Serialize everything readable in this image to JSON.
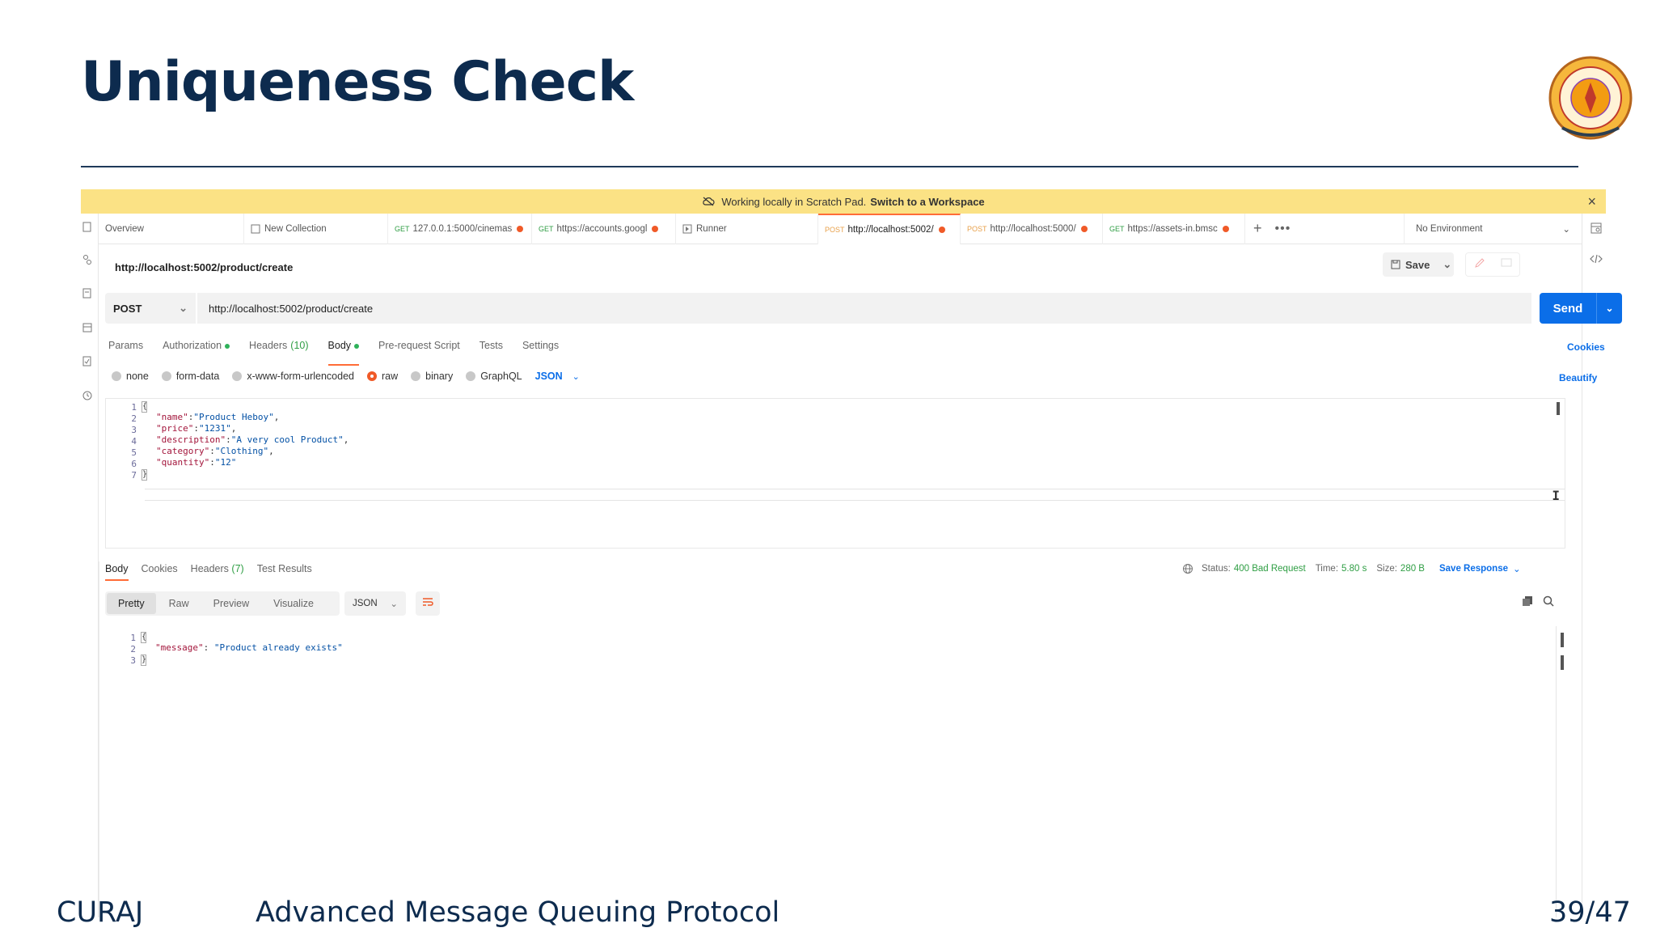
{
  "slide": {
    "title": "Uniqueness Check",
    "footer_left": "CURAJ",
    "footer_center": "Advanced Message Queuing Protocol",
    "footer_right": "39/47"
  },
  "colors": {
    "accent": "#ff6c37",
    "primary": "#0b6ee8",
    "title": "#0d2b4e",
    "banner": "#fbe285",
    "success": "#2f9e44"
  },
  "banner": {
    "text": "Working locally in Scratch Pad.",
    "link": "Switch to a Workspace"
  },
  "tabs": [
    {
      "label": "Overview"
    },
    {
      "label": "New Collection"
    },
    {
      "method": "GET",
      "label": "127.0.0.1:5000/cinemas"
    },
    {
      "method": "GET",
      "label": "https://accounts.googl"
    },
    {
      "label": "Runner"
    },
    {
      "method": "POST",
      "label": "http://localhost:5002/"
    },
    {
      "method": "POST",
      "label": "http://localhost:5000/"
    },
    {
      "method": "GET",
      "label": "https://assets-in.bmsc"
    }
  ],
  "environment": "No Environment",
  "request": {
    "name": "http://localhost:5002/product/create",
    "method": "POST",
    "url": "http://localhost:5002/product/create",
    "save_label": "Save",
    "send_label": "Send"
  },
  "req_tabs": {
    "params": "Params",
    "authorization": "Authorization",
    "headers": "Headers",
    "headers_count": "(10)",
    "body": "Body",
    "prerequest": "Pre-request Script",
    "tests": "Tests",
    "settings": "Settings",
    "cookies": "Cookies"
  },
  "body_types": {
    "none": "none",
    "form_data": "form-data",
    "urlencoded": "x-www-form-urlencoded",
    "raw": "raw",
    "binary": "binary",
    "graphql": "GraphQL",
    "format": "JSON",
    "beautify": "Beautify"
  },
  "request_body": {
    "line_numbers": [
      "1",
      "2",
      "3",
      "4",
      "5",
      "6",
      "7"
    ],
    "brace_open": "{",
    "brace_close": "}",
    "fields": [
      {
        "key": "\"name\"",
        "value": "\"Product Heboy\"",
        "trail": ","
      },
      {
        "key": "\"price\"",
        "value": "\"1231\"",
        "trail": ","
      },
      {
        "key": "\"description\"",
        "value": "\"A very cool Product\"",
        "trail": ","
      },
      {
        "key": "\"category\"",
        "value": "\"Clothing\"",
        "trail": ","
      },
      {
        "key": "\"quantity\"",
        "value": "\"12\"",
        "trail": ""
      }
    ]
  },
  "response": {
    "tabs": {
      "body": "Body",
      "cookies": "Cookies",
      "headers": "Headers",
      "headers_count": "(7)",
      "test_results": "Test Results"
    },
    "status_label": "Status:",
    "status": "400 Bad Request",
    "time_label": "Time:",
    "time": "5.80 s",
    "size_label": "Size:",
    "size": "280 B",
    "save_response": "Save Response",
    "views": {
      "pretty": "Pretty",
      "raw": "Raw",
      "preview": "Preview",
      "visualize": "Visualize"
    },
    "format": "JSON",
    "line_numbers": [
      "1",
      "2",
      "3"
    ],
    "brace_open": "{",
    "brace_close": "}",
    "message_key": "\"message\"",
    "message_value": "\"Product already exists\""
  }
}
